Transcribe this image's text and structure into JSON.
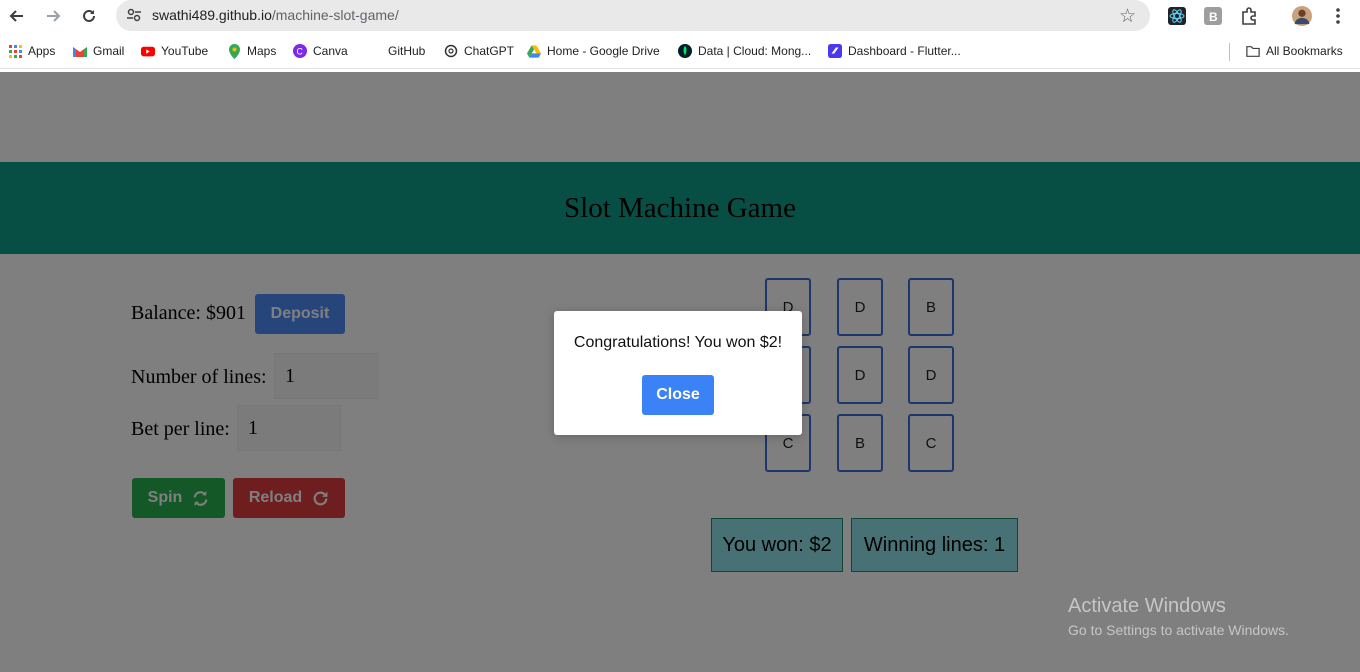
{
  "browser": {
    "url_host": "swathi489.github.io",
    "url_path": "/machine-slot-game/",
    "bookmarks": [
      {
        "label": "Apps",
        "icon": "apps-icon"
      },
      {
        "label": "Gmail",
        "icon": "gmail-icon"
      },
      {
        "label": "YouTube",
        "icon": "youtube-icon"
      },
      {
        "label": "Maps",
        "icon": "maps-icon"
      },
      {
        "label": "Canva",
        "icon": "canva-icon"
      },
      {
        "label": "GitHub",
        "icon": "github-icon"
      },
      {
        "label": "ChatGPT",
        "icon": "chatgpt-icon"
      },
      {
        "label": "Home - Google Drive",
        "icon": "drive-icon"
      },
      {
        "label": "Data | Cloud: Mong...",
        "icon": "mongodb-icon"
      },
      {
        "label": "Dashboard - Flutter...",
        "icon": "flutterflow-icon"
      }
    ],
    "all_bookmarks": "All Bookmarks"
  },
  "game": {
    "title": "Slot Machine Game",
    "balance_label": "Balance: $901",
    "deposit_label": "Deposit",
    "lines_label": "Number of lines:",
    "lines_value": "1",
    "bet_label": "Bet per line:",
    "bet_value": "1",
    "spin_label": "Spin",
    "reload_label": "Reload",
    "reels": [
      [
        "D",
        "D",
        "B"
      ],
      [
        "",
        "D",
        "D"
      ],
      [
        "C",
        "B",
        "C"
      ]
    ],
    "you_won": "You won: $2",
    "winning_lines": "Winning lines: 1"
  },
  "modal": {
    "message": "Congratulations! You won $2!",
    "close_label": "Close"
  },
  "watermark": {
    "line1": "Activate Windows",
    "line2": "Go to Settings to activate Windows."
  },
  "colors": {
    "banner": "#0f9e89",
    "deposit": "#4d8df7",
    "spin": "#2bb04f",
    "reload": "#dc3c3c",
    "close": "#3b82f6",
    "result_bg": "#8fe3ea"
  }
}
